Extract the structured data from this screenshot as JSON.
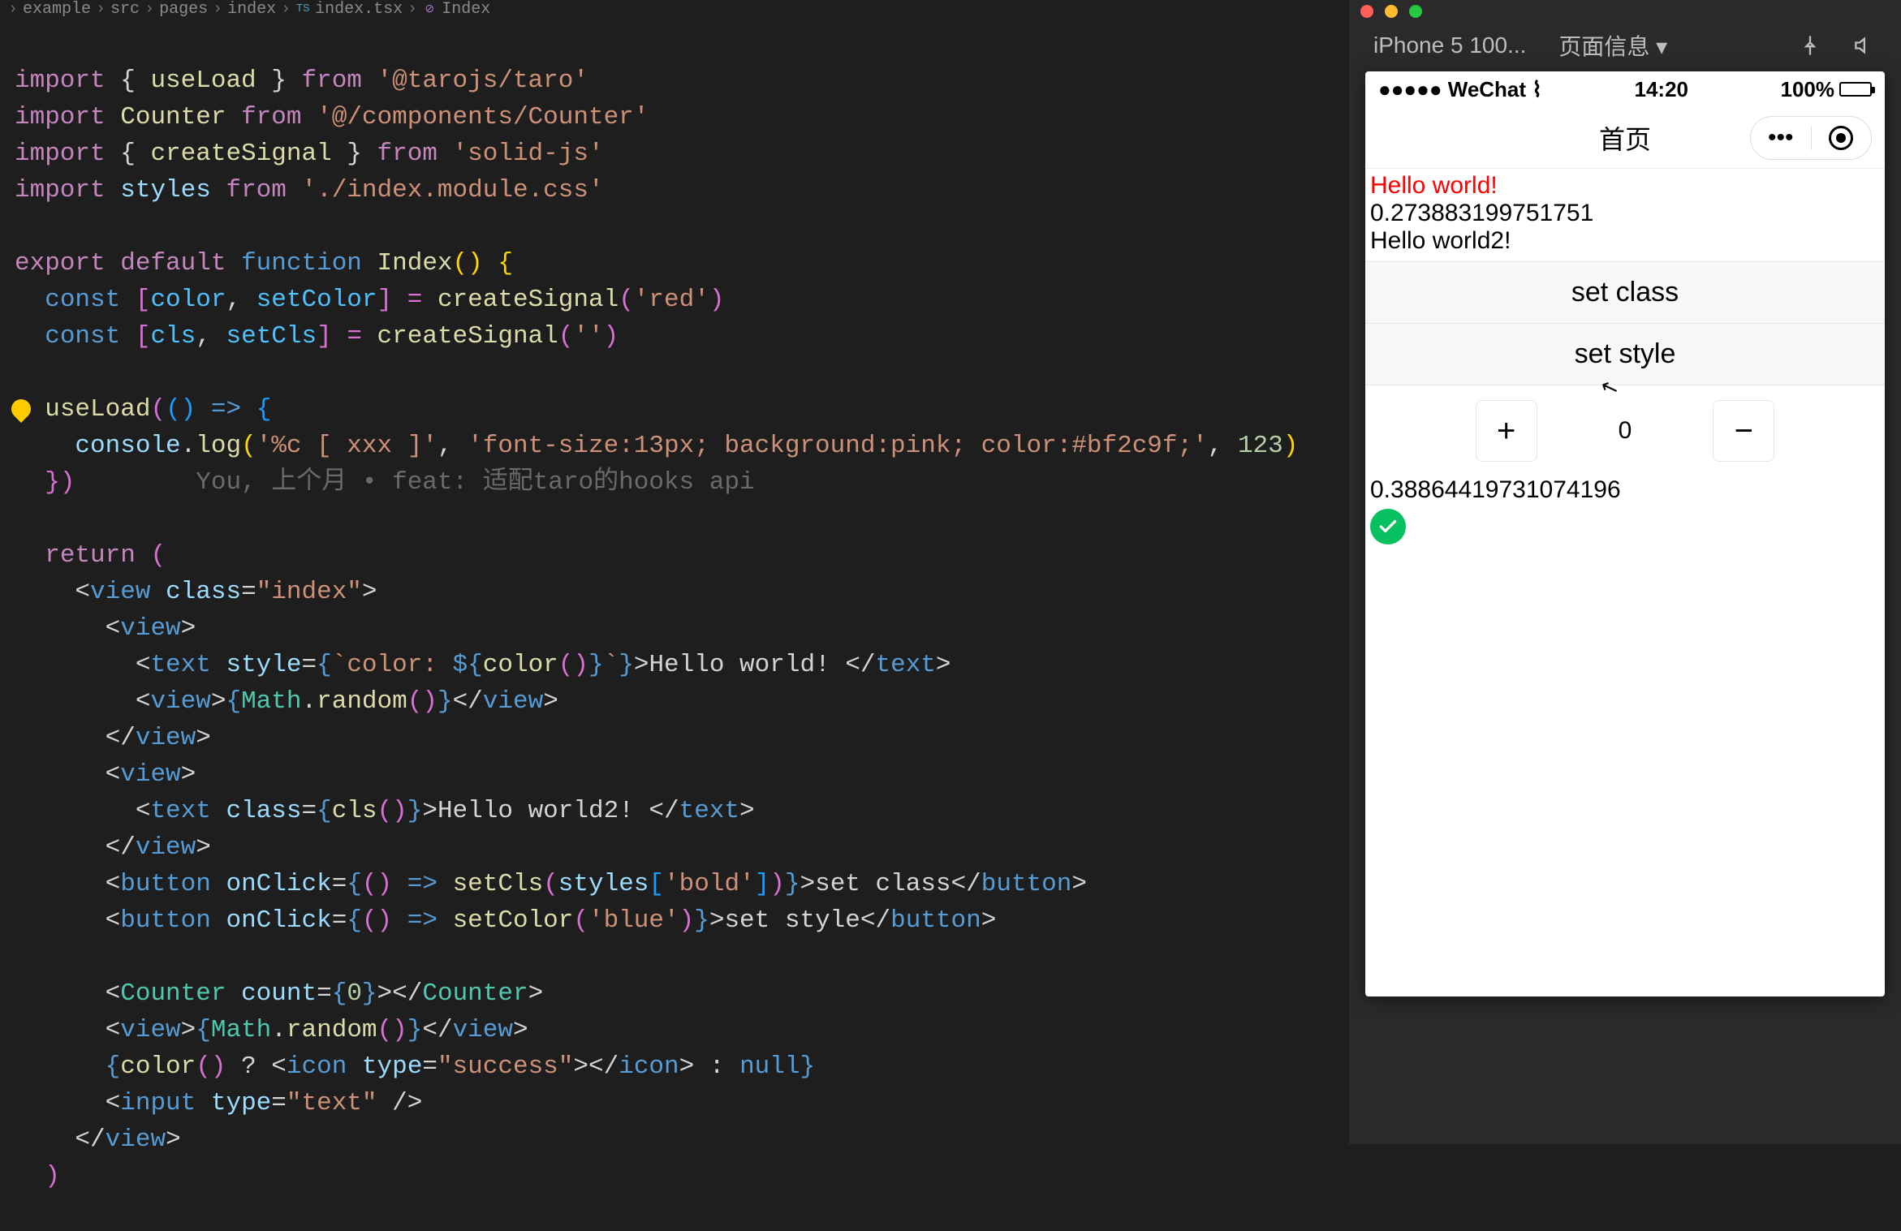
{
  "breadcrumbs": {
    "seg0": "example",
    "seg1": "src",
    "seg2": "pages",
    "seg3": "index",
    "seg4": "index.tsx",
    "seg5": "Index",
    "ts_badge": "TS",
    "fn_badge": "⊘"
  },
  "code": {
    "l1_kw1": "import",
    "l1_p1": " { ",
    "l1_fn": "useLoad",
    "l1_p2": " } ",
    "l1_kw2": "from",
    "l1_sp": " ",
    "l1_str": "'@tarojs/taro'",
    "l2_kw1": "import",
    "l2_sp1": " ",
    "l2_fn": "Counter",
    "l2_sp2": " ",
    "l2_kw2": "from",
    "l2_sp3": " ",
    "l2_str": "'@/components/Counter'",
    "l3_kw1": "import",
    "l3_p1": " { ",
    "l3_fn": "createSignal",
    "l3_p2": " } ",
    "l3_kw2": "from",
    "l3_sp": " ",
    "l3_str": "'solid-js'",
    "l4_kw1": "import",
    "l4_sp1": " ",
    "l4_var": "styles",
    "l4_sp2": " ",
    "l4_kw2": "from",
    "l4_sp3": " ",
    "l4_str": "'./index.module.css'",
    "l6_kw1": "export",
    "l6_sp1": " ",
    "l6_kw2": "default",
    "l6_sp2": " ",
    "l6_kw3": "function",
    "l6_sp3": " ",
    "l6_fn": "Index",
    "l6_p": "() {",
    "l7_ind": "  ",
    "l7_kw": "const",
    "l7_p1": " [",
    "l7_v1": "color",
    "l7_c": ", ",
    "l7_v2": "setColor",
    "l7_p2": "] = ",
    "l7_fn": "createSignal",
    "l7_p3": "(",
    "l7_str": "'red'",
    "l7_p4": ")",
    "l8_ind": "  ",
    "l8_kw": "const",
    "l8_p1": " [",
    "l8_v1": "cls",
    "l8_c": ", ",
    "l8_v2": "setCls",
    "l8_p2": "] = ",
    "l8_fn": "createSignal",
    "l8_p3": "(",
    "l8_str": "''",
    "l8_p4": ")",
    "l10_ind": "  ",
    "l10_fn": "useLoad",
    "l10_p1": "(",
    "l10_p2": "() ",
    "l10_arrow": "=>",
    "l10_p3": " {",
    "l11_ind": "    ",
    "l11_obj": "console",
    "l11_dot": ".",
    "l11_fn": "log",
    "l11_p1": "(",
    "l11_s1": "'%c [ xxx ]'",
    "l11_c1": ", ",
    "l11_s2": "'font-size:13px; background:pink; color:#bf2c9f;'",
    "l11_c2": ", ",
    "l11_n": "123",
    "l11_p2": ")",
    "l12_ind": "  ",
    "l12_p": "})",
    "l12_ghost": "        You, 上个月 • feat: 适配taro的hooks api",
    "l14_ind": "  ",
    "l14_kw": "return",
    "l14_p": " (",
    "l15_ind": "    ",
    "l15_open": "<",
    "l15_tag": "view",
    "l15_sp": " ",
    "l15_attr": "class",
    "l15_eq": "=",
    "l15_str": "\"index\"",
    "l15_close": ">",
    "l16_ind": "      ",
    "l16_open": "<",
    "l16_tag": "view",
    "l16_close": ">",
    "l17_ind": "        ",
    "l17_open": "<",
    "l17_tag": "text",
    "l17_sp": " ",
    "l17_attr": "style",
    "l17_eq": "=",
    "l17_b1": "{",
    "l17_bt1": "`",
    "l17_s1": "color: ",
    "l17_d1": "${",
    "l17_fn": "color",
    "l17_call": "()",
    "l17_d2": "}",
    "l17_bt2": "`",
    "l17_b2": "}",
    "l17_close": ">",
    "l17_txt": "Hello world! ",
    "l17_open2": "</",
    "l17_tag2": "text",
    "l17_close2": ">",
    "l18_ind": "        ",
    "l18_open": "<",
    "l18_tag": "view",
    "l18_close": ">",
    "l18_b1": "{",
    "l18_obj": "Math",
    "l18_dot": ".",
    "l18_fn": "random",
    "l18_call": "()",
    "l18_b2": "}",
    "l18_open2": "</",
    "l18_tag2": "view",
    "l18_close2": ">",
    "l19_ind": "      ",
    "l19_open": "</",
    "l19_tag": "view",
    "l19_close": ">",
    "l20_ind": "      ",
    "l20_open": "<",
    "l20_tag": "view",
    "l20_close": ">",
    "l21_ind": "        ",
    "l21_open": "<",
    "l21_tag": "text",
    "l21_sp": " ",
    "l21_attr": "class",
    "l21_eq": "=",
    "l21_b1": "{",
    "l21_fn": "cls",
    "l21_call": "()",
    "l21_b2": "}",
    "l21_close": ">",
    "l21_txt": "Hello world2! ",
    "l21_open2": "</",
    "l21_tag2": "text",
    "l21_close2": ">",
    "l22_ind": "      ",
    "l22_open": "</",
    "l22_tag": "view",
    "l22_close": ">",
    "l23_ind": "      ",
    "l23_open": "<",
    "l23_tag": "button",
    "l23_sp": " ",
    "l23_attr": "onClick",
    "l23_eq": "=",
    "l23_b1": "{",
    "l23_p1": "() ",
    "l23_arrow": "=>",
    "l23_sp2": " ",
    "l23_fn": "setCls",
    "l23_p2": "(",
    "l23_var": "styles",
    "l23_br1": "[",
    "l23_str": "'bold'",
    "l23_br2": "]",
    "l23_p3": ")",
    "l23_b2": "}",
    "l23_close": ">",
    "l23_txt": "set class",
    "l23_open2": "</",
    "l23_tag2": "button",
    "l23_close2": ">",
    "l24_ind": "      ",
    "l24_open": "<",
    "l24_tag": "button",
    "l24_sp": " ",
    "l24_attr": "onClick",
    "l24_eq": "=",
    "l24_b1": "{",
    "l24_p1": "() ",
    "l24_arrow": "=>",
    "l24_sp2": " ",
    "l24_fn": "setColor",
    "l24_p2": "(",
    "l24_str": "'blue'",
    "l24_p3": ")",
    "l24_b2": "}",
    "l24_close": ">",
    "l24_txt": "set style",
    "l24_open2": "</",
    "l24_tag2": "button",
    "l24_close2": ">",
    "l26_ind": "      ",
    "l26_open": "<",
    "l26_tag": "Counter",
    "l26_sp": " ",
    "l26_attr": "count",
    "l26_eq": "=",
    "l26_b1": "{",
    "l26_n": "0",
    "l26_b2": "}",
    "l26_close": ">",
    "l26_open2": "</",
    "l26_tag2": "Counter",
    "l26_close2": ">",
    "l27_ind": "      ",
    "l27_open": "<",
    "l27_tag": "view",
    "l27_close": ">",
    "l27_b1": "{",
    "l27_obj": "Math",
    "l27_dot": ".",
    "l27_fn": "random",
    "l27_call": "()",
    "l27_b2": "}",
    "l27_open2": "</",
    "l27_tag2": "view",
    "l27_close2": ">",
    "l28_ind": "      ",
    "l28_b1": "{",
    "l28_fn": "color",
    "l28_call": "() ",
    "l28_q": "?",
    "l28_sp": " ",
    "l28_open": "<",
    "l28_tag": "icon",
    "l28_sp2": " ",
    "l28_attr": "type",
    "l28_eq": "=",
    "l28_str": "\"success\"",
    "l28_close": ">",
    "l28_open2": "</",
    "l28_tag2": "icon",
    "l28_close2": ">",
    "l28_sp3": " ",
    "l28_colon": ":",
    "l28_sp4": " ",
    "l28_null": "null",
    "l28_b2": "}",
    "l29_ind": "      ",
    "l29_open": "<",
    "l29_tag": "input",
    "l29_sp": " ",
    "l29_attr": "type",
    "l29_eq": "=",
    "l29_str": "\"text\"",
    "l29_close": " />",
    "l30_ind": "    ",
    "l30_open": "</",
    "l30_tag": "view",
    "l30_close": ">",
    "l31_ind": "  ",
    "l31_p": ")"
  },
  "devtools": {
    "device_label": "iPhone 5 100...",
    "page_info_label": "页面信息 ▾"
  },
  "sim": {
    "carrier": "●●●●● WeChat",
    "time": "14:20",
    "battery_pct": "100%",
    "nav_title": "首页",
    "hello1": "Hello world!",
    "rand1": "0.273883199751751",
    "hello2": "Hello world2!",
    "btn_set_class": "set class",
    "btn_set_style": "set style",
    "counter_plus": "+",
    "counter_value": "0",
    "counter_minus": "−",
    "rand2": "0.38864419731074196"
  }
}
